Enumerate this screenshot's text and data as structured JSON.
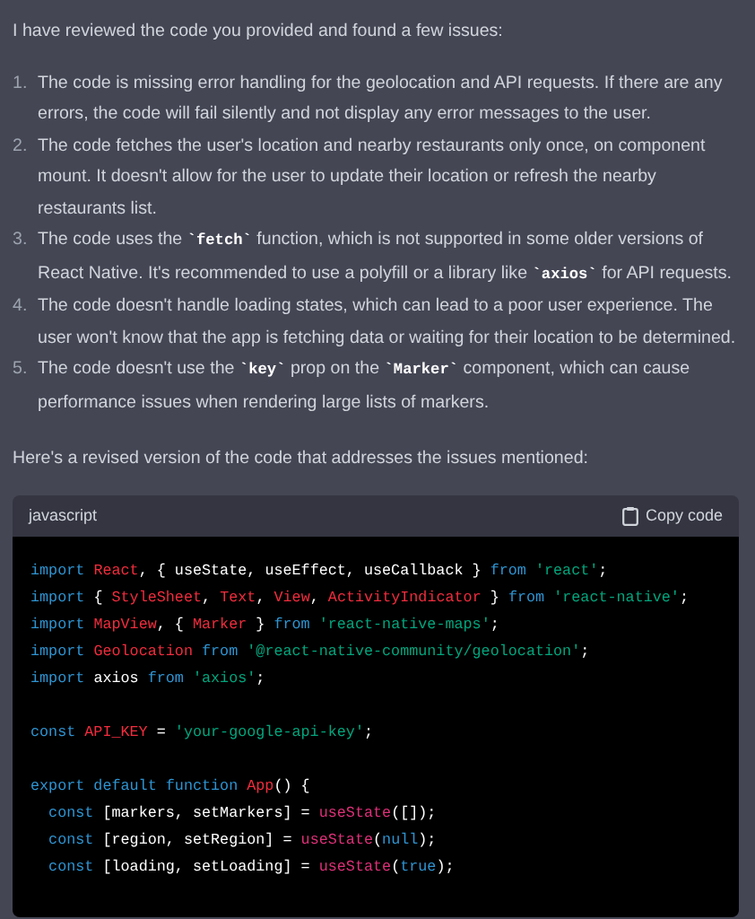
{
  "intro": "I have reviewed the code you provided and found a few issues:",
  "issues": [
    {
      "number": "1.",
      "text": "The code is missing error handling for the geolocation and API requests. If there are any errors, the code will fail silently and not display any error messages to the user."
    },
    {
      "number": "2.",
      "text": "The code fetches the user's location and nearby restaurants only once, on component mount. It doesn't allow for the user to update their location or refresh the nearby restaurants list."
    },
    {
      "number": "3.",
      "text": "The code uses the **`fetch`** function, which is not supported in some older versions of React Native. It's recommended to use a polyfill or a library like **`axios`** for API requests."
    },
    {
      "number": "4.",
      "text": "The code doesn't handle loading states, which can lead to a poor user experience. The user won't know that the app is fetching data or waiting for their location to be determined."
    },
    {
      "number": "5.",
      "text": "The code doesn't use the **`key`** prop on the **`Marker`** component, which can cause performance issues when rendering large lists of markers."
    }
  ],
  "outro": "Here's a revised version of the code that addresses the issues mentioned:",
  "code_block": {
    "language": "javascript",
    "copy_label": "Copy code",
    "groups": [
      [
        [
          {
            "text": "import ",
            "kind": "kw"
          },
          {
            "text": "React",
            "kind": "cls"
          },
          {
            "text": ", { useState, useEffect, useCallback } ",
            "kind": "txt"
          },
          {
            "text": "from ",
            "kind": "kw"
          },
          {
            "text": "'react'",
            "kind": "str"
          },
          {
            "text": ";",
            "kind": "txt"
          }
        ],
        [
          {
            "text": "import ",
            "kind": "kw"
          },
          {
            "text": "{ ",
            "kind": "txt"
          },
          {
            "text": "StyleSheet",
            "kind": "cls"
          },
          {
            "text": ", ",
            "kind": "txt"
          },
          {
            "text": "Text",
            "kind": "cls"
          },
          {
            "text": ", ",
            "kind": "txt"
          },
          {
            "text": "View",
            "kind": "cls"
          },
          {
            "text": ", ",
            "kind": "txt"
          },
          {
            "text": "ActivityIndicator",
            "kind": "cls"
          },
          {
            "text": " } ",
            "kind": "txt"
          },
          {
            "text": "from ",
            "kind": "kw"
          },
          {
            "text": "'react-native'",
            "kind": "str"
          },
          {
            "text": ";",
            "kind": "txt"
          }
        ],
        [
          {
            "text": "import ",
            "kind": "kw"
          },
          {
            "text": "MapView",
            "kind": "cls"
          },
          {
            "text": ", { ",
            "kind": "txt"
          },
          {
            "text": "Marker",
            "kind": "cls"
          },
          {
            "text": " } ",
            "kind": "txt"
          },
          {
            "text": "from ",
            "kind": "kw"
          },
          {
            "text": "'react-native-maps'",
            "kind": "str"
          },
          {
            "text": ";",
            "kind": "txt"
          }
        ],
        [
          {
            "text": "import ",
            "kind": "kw"
          },
          {
            "text": "Geolocation",
            "kind": "cls"
          },
          {
            "text": " from ",
            "kind": "kw"
          },
          {
            "text": "'@react-native-community/geolocation'",
            "kind": "str"
          },
          {
            "text": ";",
            "kind": "txt"
          }
        ],
        [
          {
            "text": "import ",
            "kind": "kw"
          },
          {
            "text": "axios ",
            "kind": "txt"
          },
          {
            "text": "from ",
            "kind": "kw"
          },
          {
            "text": "'axios'",
            "kind": "str"
          },
          {
            "text": ";",
            "kind": "txt"
          }
        ]
      ],
      [
        [
          {
            "text": "const ",
            "kind": "kw"
          },
          {
            "text": "API_KEY",
            "kind": "cls"
          },
          {
            "text": " = ",
            "kind": "txt"
          },
          {
            "text": "'your-google-api-key'",
            "kind": "str"
          },
          {
            "text": ";",
            "kind": "txt"
          }
        ]
      ],
      [
        [
          {
            "text": "export default function ",
            "kind": "kw"
          },
          {
            "text": "App",
            "kind": "cls"
          },
          {
            "text": "() {",
            "kind": "txt"
          }
        ],
        [
          {
            "text": "  const ",
            "kind": "kw"
          },
          {
            "text": "[markers, setMarkers] = ",
            "kind": "txt"
          },
          {
            "text": "useState",
            "kind": "fn"
          },
          {
            "text": "([]);",
            "kind": "txt"
          }
        ],
        [
          {
            "text": "  const ",
            "kind": "kw"
          },
          {
            "text": "[region, setRegion] = ",
            "kind": "txt"
          },
          {
            "text": "useState",
            "kind": "fn"
          },
          {
            "text": "(",
            "kind": "txt"
          },
          {
            "text": "null",
            "kind": "kw"
          },
          {
            "text": ");",
            "kind": "txt"
          }
        ],
        [
          {
            "text": "  const ",
            "kind": "kw"
          },
          {
            "text": "[loading, setLoading] = ",
            "kind": "txt"
          },
          {
            "text": "useState",
            "kind": "fn"
          },
          {
            "text": "(",
            "kind": "txt"
          },
          {
            "text": "true",
            "kind": "kw"
          },
          {
            "text": ");",
            "kind": "txt"
          }
        ]
      ]
    ]
  }
}
